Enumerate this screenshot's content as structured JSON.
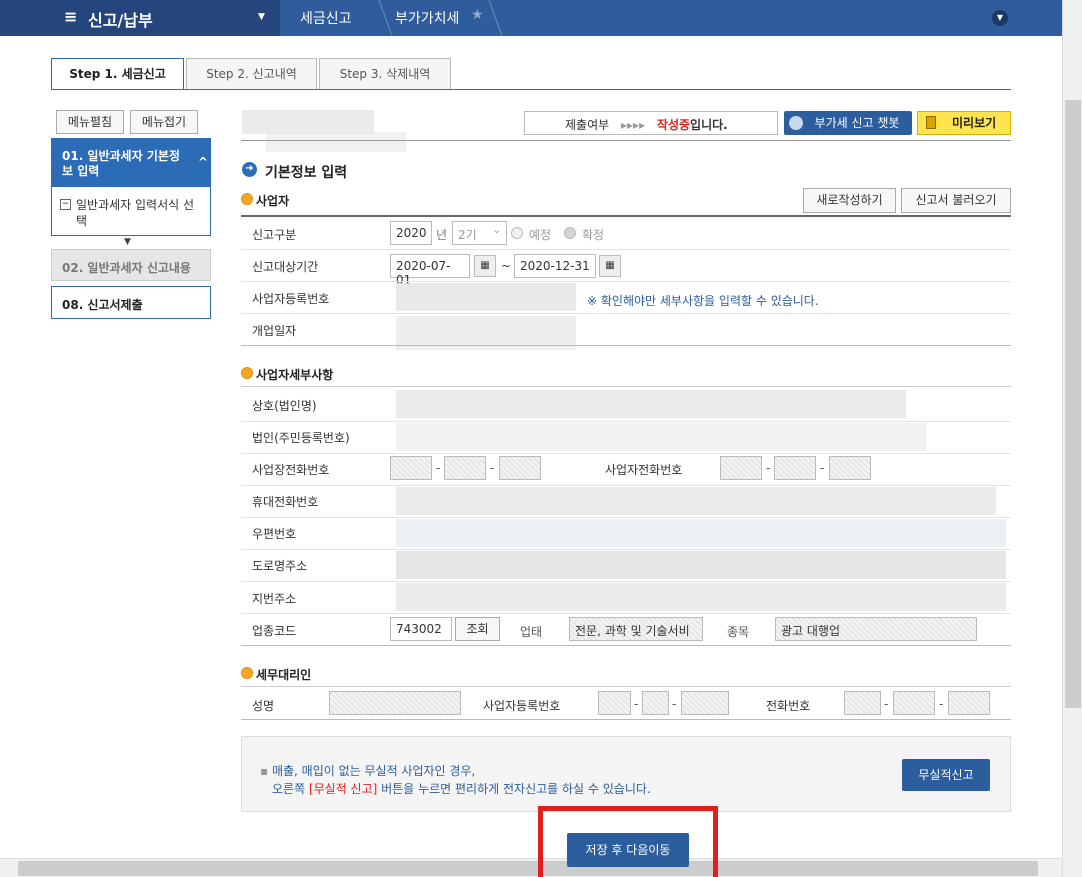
{
  "nav": {
    "menu": "신고/납부",
    "crumb1": "세금신고",
    "crumb2": "부가가치세",
    "star": "★",
    "caret": "▼",
    "hamb": "≡",
    "expand": "⌄"
  },
  "tabs": [
    "Step 1. 세금신고",
    "Step 2. 신고내역",
    "Step 3. 삭제내역"
  ],
  "side": {
    "expand": "메뉴펼침",
    "collapse": "메뉴접기",
    "item1": "01. 일반과세자 기본정보 입력",
    "item1_sub": "일반과세자 입력서식 선택",
    "item2": "02. 일반과세자 신고내용",
    "item3": "08. 신고서제출",
    "arrow": "▼",
    "up": "^",
    "box": "−"
  },
  "status": {
    "label": "제출여부",
    "arrows": "▸▸▸▸",
    "state": "작성중",
    "suffix": "입니다."
  },
  "buttons": {
    "chatbot": "부가세 신고 챗봇",
    "preview": "미리보기",
    "new": "새로작성하기",
    "load": "신고서 불러오기",
    "lookup": "조회",
    "nonactive": "무실적신고",
    "save": "저장 후 다음이동"
  },
  "basic_title": "기본정보 입력",
  "sections": {
    "business": "사업자",
    "detail": "사업자세부사항",
    "agent": "세무대리인"
  },
  "fields": {
    "report_type": "신고구분",
    "year": "2020",
    "year_unit": "년",
    "period": "2기",
    "expected": "예정",
    "confirmed": "확정",
    "target_period": "신고대상기간",
    "from": "2020-07-01",
    "to": "2020-12-31",
    "tilde": "~",
    "regno": "사업자등록번호",
    "open_date": "개업일자",
    "notice": "※ 확인해야만 세부사항을 입력할 수 있습니다.",
    "company": "상호(법인명)",
    "corp": "법인(주민등록번호)",
    "biz_phone": "사업장전화번호",
    "owner_phone": "사업자전화번호",
    "mobile": "휴대전화번호",
    "zip": "우편번호",
    "road": "도로명주소",
    "lot": "지번주소",
    "code_label": "업종코드",
    "code": "743002",
    "sector_label": "업태",
    "sector": "전문, 과학 및 기술서비",
    "type_label": "종목",
    "type": "광고 대행업",
    "name": "성명",
    "agent_regno": "사업자등록번호",
    "agent_phone": "전화번호",
    "dash": "-"
  },
  "notice_box": {
    "line1": "매출, 매입이 없는 무실적 사업자인 경우,",
    "line2a": "오른쪽 ",
    "line2b": "[무실적 신고]",
    "line2c": " 버튼을 누르면 편리하게 전자신고를 하실 수 있습니다."
  },
  "colors": {
    "accent": "#2c6bb5",
    "highlight": "#e0201f",
    "status": "#d6221c"
  }
}
